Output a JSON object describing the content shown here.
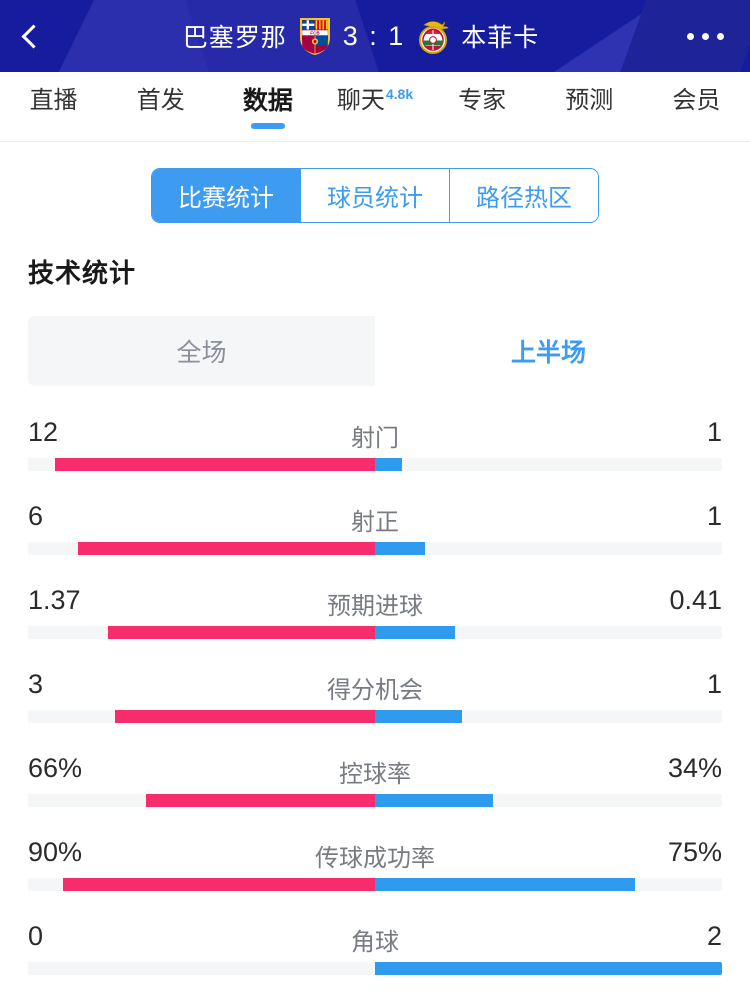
{
  "header": {
    "back_icon": "chevron-left-icon",
    "more_icon": "more-horizontal-icon",
    "home_team": "巴塞罗那",
    "away_team": "本菲卡",
    "score": "3 : 1",
    "home_crest_icon": "fc-barcelona-crest-icon",
    "away_crest_icon": "sl-benfica-crest-icon",
    "bg_color": "#161C9E"
  },
  "nav": {
    "items": [
      {
        "label": "直播",
        "active": false,
        "badge": ""
      },
      {
        "label": "首发",
        "active": false,
        "badge": ""
      },
      {
        "label": "数据",
        "active": true,
        "badge": ""
      },
      {
        "label": "聊天",
        "active": false,
        "badge": "4.8k"
      },
      {
        "label": "专家",
        "active": false,
        "badge": ""
      },
      {
        "label": "预测",
        "active": false,
        "badge": ""
      },
      {
        "label": "会员",
        "active": false,
        "badge": ""
      }
    ],
    "accent_color": "#3D9BF0"
  },
  "segmented": {
    "options": [
      {
        "label": "比赛统计",
        "active": true
      },
      {
        "label": "球员统计",
        "active": false
      },
      {
        "label": "路径热区",
        "active": false
      }
    ]
  },
  "section": {
    "title": "技术统计"
  },
  "period_toggle": {
    "options": [
      {
        "label": "全场",
        "active": false
      },
      {
        "label": "上半场",
        "active": true
      }
    ]
  },
  "colors": {
    "home_bar": "#F72C6C",
    "away_bar": "#2F9BEE",
    "track": "#F5F6F8",
    "accent": "#3D9BF0"
  },
  "chart_data": {
    "type": "bar",
    "title": "技术统计",
    "subtitle": "上半场",
    "orientation": "horizontal-diverging",
    "series": [
      {
        "name": "巴塞罗那",
        "color": "#F72C6C",
        "side": "left"
      },
      {
        "name": "本菲卡",
        "color": "#2F9BEE",
        "side": "right"
      }
    ],
    "categories": [
      "射门",
      "射正",
      "预期进球",
      "得分机会",
      "控球率",
      "传球成功率",
      "角球"
    ],
    "rows": [
      {
        "label": "射门",
        "home": "12",
        "away": "1",
        "home_frac": 0.923,
        "away_frac": 0.077
      },
      {
        "label": "射正",
        "home": "6",
        "away": "1",
        "home_frac": 0.857,
        "away_frac": 0.143
      },
      {
        "label": "预期进球",
        "home": "1.37",
        "away": "0.41",
        "home_frac": 0.77,
        "away_frac": 0.23
      },
      {
        "label": "得分机会",
        "home": "3",
        "away": "1",
        "home_frac": 0.75,
        "away_frac": 0.25
      },
      {
        "label": "控球率",
        "home": "66%",
        "away": "34%",
        "home_frac": 0.66,
        "away_frac": 0.34
      },
      {
        "label": "传球成功率",
        "home": "90%",
        "away": "75%",
        "home_frac": 0.9,
        "away_frac": 0.75
      },
      {
        "label": "角球",
        "home": "0",
        "away": "2",
        "home_frac": 0.0,
        "away_frac": 1.0
      }
    ]
  }
}
